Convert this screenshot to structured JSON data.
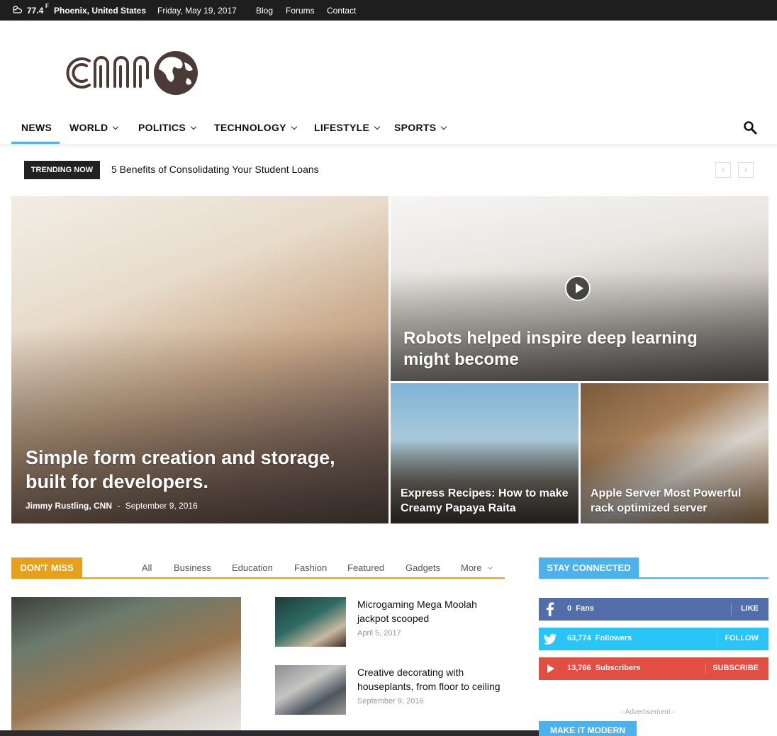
{
  "topbar": {
    "temperature": "77.4",
    "unit": "F",
    "location": "Phoenix, United States",
    "date": "Friday, May 19, 2017",
    "links": [
      "Blog",
      "Forums",
      "Contact"
    ]
  },
  "nav": {
    "items": [
      {
        "label": "NEWS",
        "dropdown": false,
        "active": true
      },
      {
        "label": "WORLD",
        "dropdown": true
      },
      {
        "label": "POLITICS",
        "dropdown": true
      },
      {
        "label": "TECHNOLOGY",
        "dropdown": true
      },
      {
        "label": "LIFESTYLE",
        "dropdown": true
      },
      {
        "label": "SPORTS",
        "dropdown": true
      }
    ]
  },
  "trending": {
    "label": "TRENDING NOW",
    "headline": "5 Benefits of Consolidating Your Student Loans",
    "prev": "‹",
    "next": "›"
  },
  "hero": {
    "main": {
      "title": "Simple form creation and storage, built for developers.",
      "author": "Jimmy Rustling, CNN",
      "separator": "-",
      "date": "September 9, 2016"
    },
    "top_right": {
      "title": "Robots helped inspire deep learning might become"
    },
    "bottom_left": {
      "title": "Express Recipes: How to make Creamy Papaya Raita"
    },
    "bottom_right": {
      "title": "Apple Server Most Powerful rack optimized server"
    }
  },
  "dont_miss": {
    "label": "DON'T MISS",
    "tabs": [
      "All",
      "Business",
      "Education",
      "Fashion",
      "Featured",
      "Gadgets",
      "More"
    ],
    "items": [
      {
        "title": "Microgaming Mega Moolah jackpot scooped",
        "date": "April 5, 2017"
      },
      {
        "title": "Creative decorating with houseplants, from floor to ceiling",
        "date": "September 9, 2016"
      }
    ]
  },
  "stay_connected": {
    "label": "STAY CONNECTED",
    "facebook": {
      "count": "0",
      "unit": "Fans",
      "action": "LIKE"
    },
    "twitter": {
      "count": "63,774",
      "unit": "Followers",
      "action": "FOLLOW"
    },
    "youtube": {
      "count": "13,766",
      "unit": "Subscribers",
      "action": "SUBSCRIBE"
    },
    "advertisement": "- Advertisement -",
    "make_it_modern": "MAKE IT MODERN"
  },
  "colors": {
    "accent_blue": "#4db2ec",
    "dont_miss_orange": "#e5a11c",
    "facebook": "#516eab",
    "twitter": "#29c5f6",
    "youtube": "#e14e42",
    "logo": "#4a3b36"
  }
}
